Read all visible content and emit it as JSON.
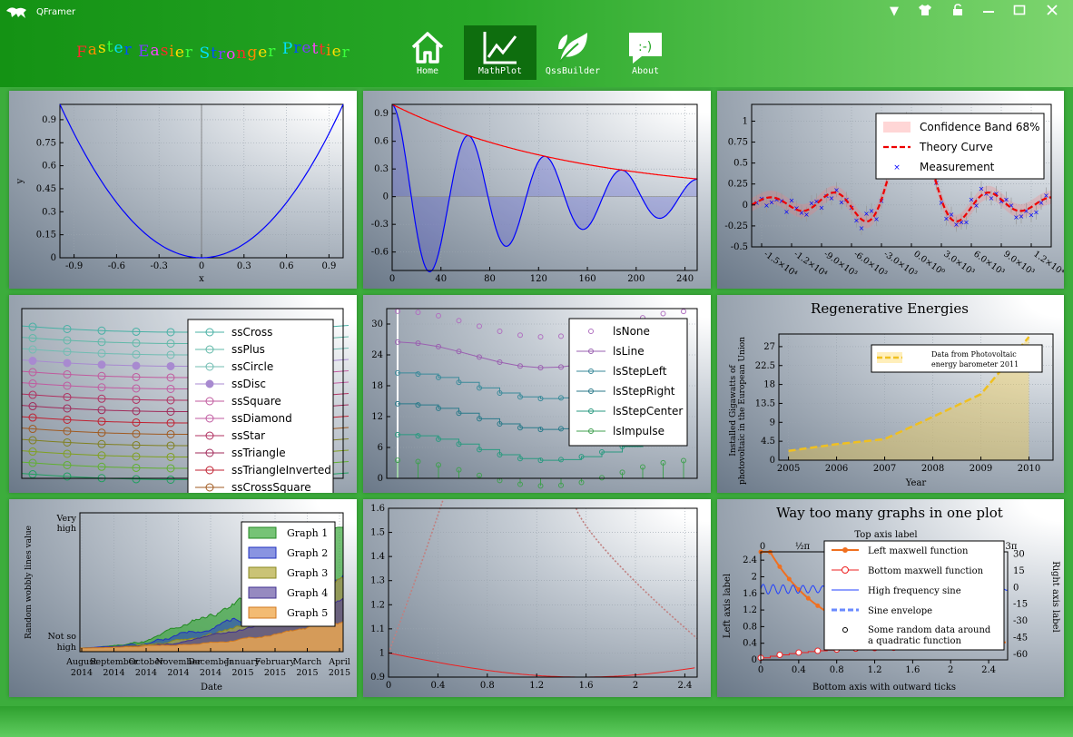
{
  "app": {
    "title": "QFramer"
  },
  "slogan": [
    {
      "text": "F",
      "color": "#ff2a2a"
    },
    {
      "text": "a",
      "color": "#ff8a00"
    },
    {
      "text": "s",
      "color": "#ffdf00"
    },
    {
      "text": "t",
      "color": "#3aff3a"
    },
    {
      "text": "e",
      "color": "#00e0ff"
    },
    {
      "text": "r",
      "color": "#0050ff"
    },
    {
      "text": " ",
      "color": "#ffffff"
    },
    {
      "text": "E",
      "color": "#7a40ff"
    },
    {
      "text": "a",
      "color": "#ff40ff"
    },
    {
      "text": "s",
      "color": "#ff2a2a"
    },
    {
      "text": "i",
      "color": "#ff8a00"
    },
    {
      "text": "e",
      "color": "#ffdf00"
    },
    {
      "text": "r",
      "color": "#3aff3a"
    },
    {
      "text": " ",
      "color": "#ffffff"
    },
    {
      "text": "S",
      "color": "#00e0ff"
    },
    {
      "text": "t",
      "color": "#0050ff"
    },
    {
      "text": "r",
      "color": "#7a40ff"
    },
    {
      "text": "o",
      "color": "#ff40ff"
    },
    {
      "text": "n",
      "color": "#ff2a2a"
    },
    {
      "text": "g",
      "color": "#ff8a00"
    },
    {
      "text": "e",
      "color": "#ffdf00"
    },
    {
      "text": "r",
      "color": "#3aff3a"
    },
    {
      "text": " ",
      "color": "#ffffff"
    },
    {
      "text": "P",
      "color": "#00e0ff"
    },
    {
      "text": "r",
      "color": "#0050ff"
    },
    {
      "text": "e",
      "color": "#7a40ff"
    },
    {
      "text": "t",
      "color": "#ff40ff"
    },
    {
      "text": "t",
      "color": "#ff2a2a"
    },
    {
      "text": "i",
      "color": "#ff8a00"
    },
    {
      "text": "e",
      "color": "#ffdf00"
    },
    {
      "text": "r",
      "color": "#3aff3a"
    }
  ],
  "window_controls": [
    {
      "name": "menu",
      "glyph": "▼"
    },
    {
      "name": "skin",
      "glyph": "👕"
    },
    {
      "name": "lock",
      "glyph": "🔓"
    },
    {
      "name": "minimize",
      "glyph": "—"
    },
    {
      "name": "maximize",
      "glyph": "☐"
    },
    {
      "name": "close",
      "glyph": "✕"
    }
  ],
  "nav": [
    {
      "label": "Home",
      "icon": "home-icon"
    },
    {
      "label": "MathPlot",
      "icon": "chart-line-icon",
      "active": true
    },
    {
      "label": "QssBuilder",
      "icon": "leaf-icon"
    },
    {
      "label": "About",
      "icon": "chat-bubble-icon"
    }
  ],
  "colors": {
    "accent": "#1a9a1a",
    "active_tab": "#0e6e0e"
  },
  "chart_data": [
    {
      "id": "quadratic",
      "type": "line",
      "xlabel": "x",
      "ylabel": "y",
      "xlim": [
        -1,
        1
      ],
      "ylim": [
        0,
        1
      ],
      "xticks": [
        "-0.9",
        "-0.6",
        "-0.3",
        "0",
        "0.3",
        "0.6",
        "0.9"
      ],
      "yticks": [
        "0",
        "0.15",
        "0.3",
        "0.45",
        "0.6",
        "0.75",
        "0.9"
      ],
      "series": [
        {
          "formula": "y = x^2",
          "color": "#0000ff"
        }
      ]
    },
    {
      "id": "damped-oscillation",
      "type": "line",
      "xlim": [
        0,
        250
      ],
      "ylim": [
        -0.8,
        1
      ],
      "xticks": [
        "0",
        "40",
        "80",
        "120",
        "160",
        "200",
        "240"
      ],
      "yticks": [
        "0.9",
        "0.6",
        "0.3",
        "0",
        "-0.3",
        "-0.6"
      ],
      "series": [
        {
          "formula": "y = exp(-0.0066 x) * cos(x/10)",
          "color": "#0000ff"
        },
        {
          "formula": "y = exp(-0.0066 x)",
          "color": "#ff0000"
        }
      ]
    },
    {
      "id": "statistical",
      "type": "line",
      "ylim": [
        -0.5,
        1.2
      ],
      "xticks": [
        "-1.5×10⁴",
        "-1.2×10⁴",
        "-9.0×10³",
        "-6.0×10³",
        "-3.0×10³",
        "0.0×10⁰",
        "3.0×10³",
        "6.0×10³",
        "9.0×10³",
        "1.2×10⁴"
      ],
      "yticks": [
        "1",
        "0.75",
        "0.5",
        "0.25",
        "0",
        "-0.25",
        "-0.5"
      ],
      "legend": [
        "Confidence Band 68%",
        "Theory Curve",
        "Measurement"
      ]
    },
    {
      "id": "scatter-styles",
      "type": "scatter",
      "legend": [
        "ssCross",
        "ssPlus",
        "ssCircle",
        "ssDisc",
        "ssSquare",
        "ssDiamond",
        "ssStar",
        "ssTriangle",
        "ssTriangleInverted",
        "ssCrossSquare"
      ]
    },
    {
      "id": "line-styles",
      "type": "line",
      "ylim": [
        0,
        33
      ],
      "yticks": [
        "30",
        "24",
        "18",
        "12",
        "6",
        "0"
      ],
      "legend": [
        "lsNone",
        "lsLine",
        "lsStepLeft",
        "lsStepRight",
        "lsStepCenter",
        "lsImpulse"
      ]
    },
    {
      "id": "regenerative",
      "type": "area",
      "title": "Regenerative Energies",
      "xlabel": "Year",
      "ylabel": "Installed Gigawatts of photovoltaic in the European Union",
      "x": [
        2005,
        2006,
        2007,
        2008,
        2009,
        2010
      ],
      "values": [
        2.2,
        3.8,
        5.0,
        10.3,
        15.7,
        29.3
      ],
      "xticks": [
        "2005",
        "2006",
        "2007",
        "2008",
        "2009",
        "2010"
      ],
      "yticks": [
        "27",
        "22.5",
        "18",
        "13.5",
        "9",
        "4.5",
        "0"
      ],
      "ylim": [
        0,
        30
      ],
      "legend": [
        "Data from Photovoltaic energy barometer 2011"
      ]
    },
    {
      "id": "date-graphs",
      "type": "area",
      "xlabel": "Date",
      "ylabel": "Random wobbly lines value",
      "xticks": [
        [
          "August",
          "2014"
        ],
        [
          "September",
          "2014"
        ],
        [
          "October",
          "2014"
        ],
        [
          "November",
          "2014"
        ],
        [
          "December",
          "2014"
        ],
        [
          "January",
          "2015"
        ],
        [
          "February",
          "2015"
        ],
        [
          "March",
          "2015"
        ],
        [
          "April",
          "2015"
        ]
      ],
      "yticks": [
        "Very high",
        "Not so high"
      ],
      "legend": [
        "Graph 1",
        "Graph 2",
        "Graph 3",
        "Graph 4",
        "Graph 5"
      ]
    },
    {
      "id": "parametric",
      "type": "line",
      "xlim": [
        0,
        2.5
      ],
      "ylim": [
        0.9,
        1.6
      ],
      "xticks": [
        "0",
        "0.4",
        "0.8",
        "1.2",
        "1.6",
        "2",
        "2.4"
      ],
      "yticks": [
        "1.6",
        "1.5",
        "1.4",
        "1.3",
        "1.2",
        "1.1",
        "1",
        "0.9"
      ]
    },
    {
      "id": "multi-axis",
      "type": "line",
      "title": "Way too many graphs in one plot",
      "top_label": "Top axis label",
      "xlabel": "Bottom axis with outward ticks",
      "ylabel": "Left axis label",
      "y2label": "Right axis label",
      "top_ticks": [
        "0",
        "½π",
        "3π"
      ],
      "xticks": [
        "0",
        "0.4",
        "0.8",
        "1.2",
        "1.6",
        "2",
        "2.4"
      ],
      "yticks": [
        "2.4",
        "2",
        "1.6",
        "1.2",
        "0.8",
        "0.4",
        "0"
      ],
      "y2ticks": [
        "30",
        "15",
        "0",
        "-15",
        "-30",
        "-45",
        "-60"
      ],
      "legend": [
        "Left maxwell function",
        "Bottom maxwell function",
        "High frequency sine",
        "Sine envelope",
        "Some random data around a quadratic function"
      ]
    }
  ]
}
